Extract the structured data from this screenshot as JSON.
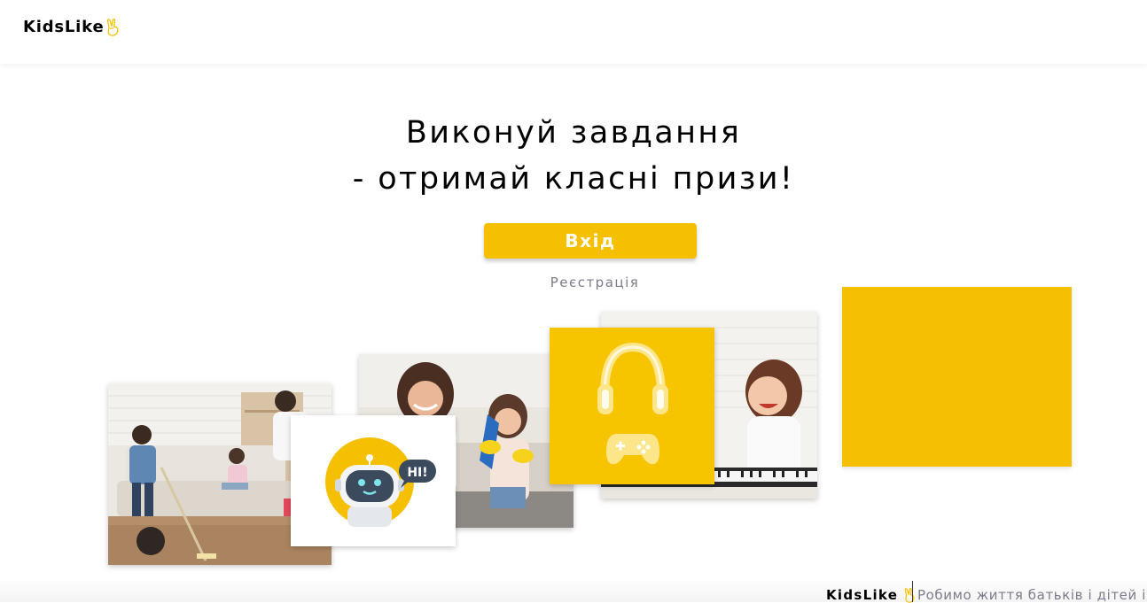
{
  "header": {
    "logo_text": "KidsLike",
    "logo_icon": "victory-hand-icon"
  },
  "hero": {
    "title_line1": "Виконуй завдання",
    "title_line2": "- отримай класні призи!"
  },
  "auth": {
    "login_label": "Вхід",
    "register_label": "Реєстрація"
  },
  "gallery": {
    "images": [
      "kids-cleaning-photo",
      "robot-hi-illustration",
      "mom-and-girl-cleaning-photo",
      "headphones-gamepad-illustration",
      "girl-piano-photo",
      "yellow-tile"
    ]
  },
  "footer": {
    "logo_text": "KidsLike",
    "tagline": "Робимо життя батьків і дітей ізі"
  },
  "colors": {
    "accent": "#f5c002",
    "muted_text": "#7c7c8a"
  }
}
